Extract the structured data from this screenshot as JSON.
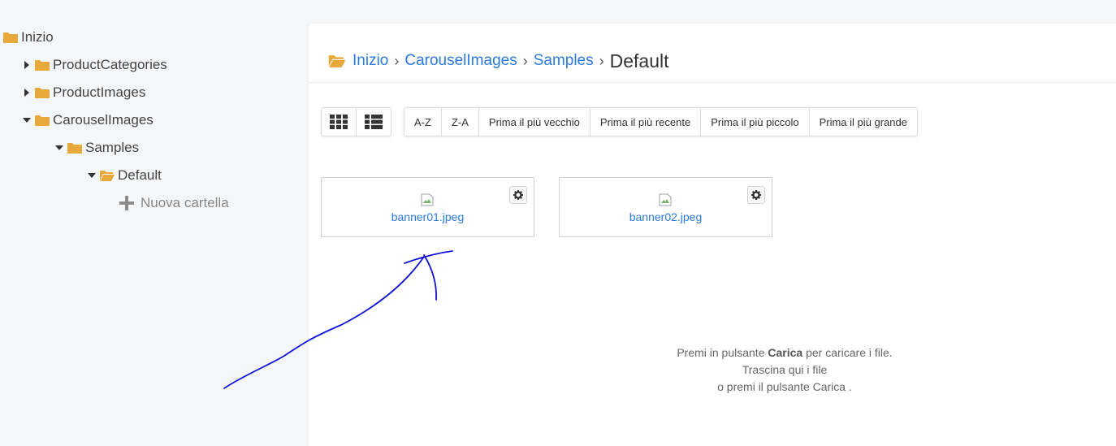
{
  "tree": {
    "root": "Inizio",
    "items": [
      {
        "label": "ProductCategories",
        "state": "collapsed"
      },
      {
        "label": "ProductImages",
        "state": "collapsed"
      },
      {
        "label": "CarouselImages",
        "state": "expanded"
      },
      {
        "label": "Samples",
        "state": "expanded"
      },
      {
        "label": "Default",
        "state": "open"
      }
    ],
    "new_folder": "Nuova cartella"
  },
  "breadcrumb": {
    "items": [
      "Inizio",
      "CarouselImages",
      "Samples"
    ],
    "separator": "›",
    "current": "Default"
  },
  "toolbar": {
    "view_buttons": [
      "grid-view-icon",
      "list-view-icon"
    ],
    "sort_buttons": [
      "A-Z",
      "Z-A",
      "Prima il più vecchio",
      "Prima il più recente",
      "Prima il più piccolo",
      "Prima il più grande"
    ]
  },
  "files": [
    {
      "name": "banner01.jpeg"
    },
    {
      "name": "banner02.jpeg"
    }
  ],
  "dropzone": {
    "line1_before": "Premi in pulsante ",
    "line1_bold": "Carica",
    "line1_after": " per caricare i file.",
    "line2": "Trascina qui i file",
    "line3": "o premi il pulsante Carica ."
  },
  "colors": {
    "folder": "#e8a93b",
    "link": "#2a7ae2",
    "annotation": "#1010d6"
  }
}
